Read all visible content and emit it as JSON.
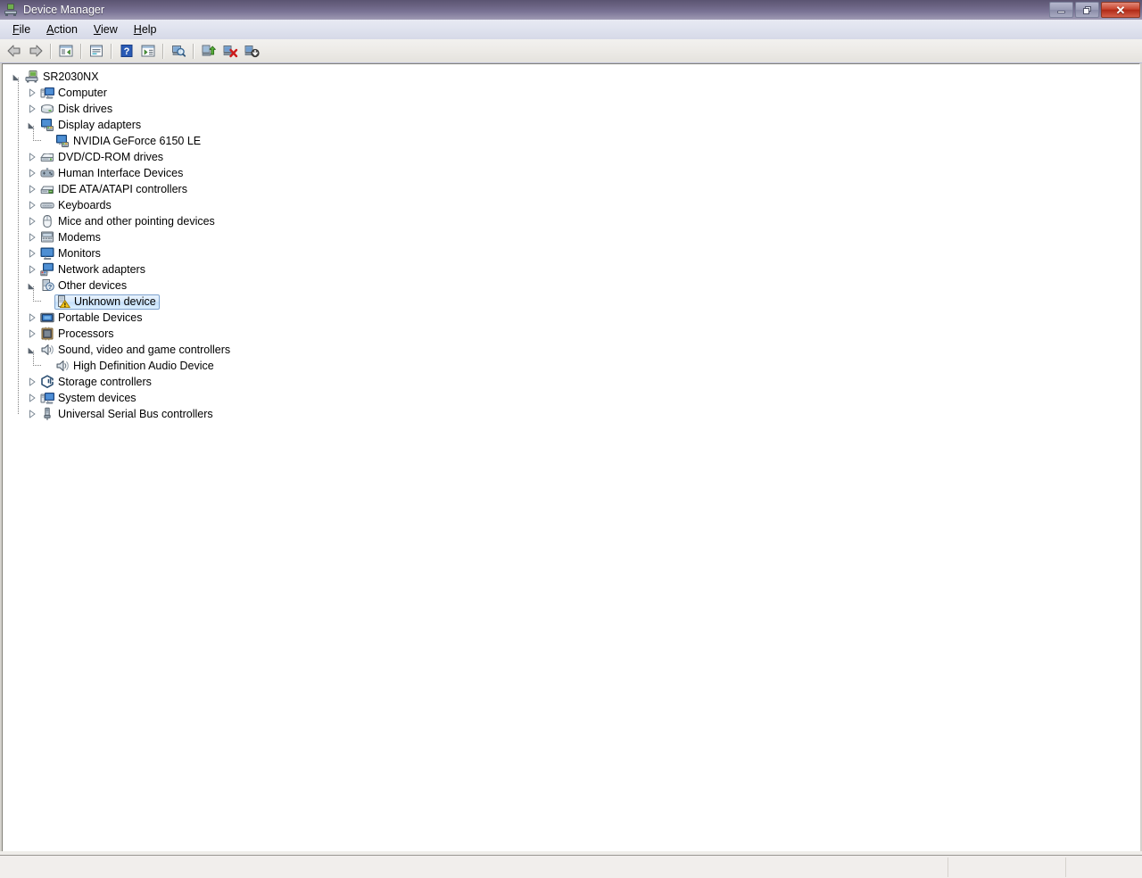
{
  "window": {
    "title": "Device Manager",
    "app_icon": "device-manager-icon",
    "controls": {
      "minimize_label": "Minimize",
      "restore_label": "Restore",
      "close_label": "✕"
    }
  },
  "menubar": {
    "items": [
      {
        "label": "File",
        "accel": "F"
      },
      {
        "label": "Action",
        "accel": "A"
      },
      {
        "label": "View",
        "accel": "V"
      },
      {
        "label": "Help",
        "accel": "H"
      }
    ]
  },
  "toolbar": {
    "buttons": [
      {
        "name": "back-button",
        "icon": "back-arrow-icon",
        "label": "Back"
      },
      {
        "name": "forward-button",
        "icon": "forward-arrow-icon",
        "label": "Forward"
      },
      {
        "name": "separator-1",
        "icon": "separator",
        "label": ""
      },
      {
        "name": "show-hide-console-tree-button",
        "icon": "console-tree-icon",
        "label": "Show/Hide Console Tree"
      },
      {
        "name": "separator-2",
        "icon": "separator",
        "label": ""
      },
      {
        "name": "properties-button",
        "icon": "properties-icon",
        "label": "Properties"
      },
      {
        "name": "separator-3",
        "icon": "separator",
        "label": ""
      },
      {
        "name": "help-button",
        "icon": "help-question-icon",
        "label": "Help"
      },
      {
        "name": "show-hide-action-pane-button",
        "icon": "action-pane-icon",
        "label": "Show/Hide Action Pane"
      },
      {
        "name": "separator-4",
        "icon": "separator",
        "label": ""
      },
      {
        "name": "scan-for-hardware-changes-button",
        "icon": "scan-magnifier-icon",
        "label": "Scan for hardware changes"
      },
      {
        "name": "separator-5",
        "icon": "separator",
        "label": ""
      },
      {
        "name": "update-driver-button",
        "icon": "update-driver-icon",
        "label": "Update Driver Software"
      },
      {
        "name": "uninstall-device-button",
        "icon": "uninstall-red-x-icon",
        "label": "Uninstall"
      },
      {
        "name": "disable-device-button",
        "icon": "disable-down-arrow-icon",
        "label": "Disable"
      }
    ]
  },
  "tree": {
    "nodes": [
      {
        "label": "SR2030NX",
        "indent": 0,
        "state": "expanded-root",
        "icon": "computer-tower-icon",
        "selected": false
      },
      {
        "label": "Computer",
        "indent": 1,
        "state": "collapsed",
        "icon": "computer-icon",
        "selected": false
      },
      {
        "label": "Disk drives",
        "indent": 1,
        "state": "collapsed",
        "icon": "disk-drive-icon",
        "selected": false
      },
      {
        "label": "Display adapters",
        "indent": 1,
        "state": "expanded",
        "icon": "display-adapter-icon",
        "selected": false
      },
      {
        "label": "NVIDIA GeForce 6150 LE",
        "indent": 2,
        "state": "leaf",
        "icon": "display-adapter-icon",
        "selected": false
      },
      {
        "label": "DVD/CD-ROM drives",
        "indent": 1,
        "state": "collapsed",
        "icon": "dvd-drive-icon",
        "selected": false
      },
      {
        "label": "Human Interface Devices",
        "indent": 1,
        "state": "collapsed",
        "icon": "hid-icon",
        "selected": false
      },
      {
        "label": "IDE ATA/ATAPI controllers",
        "indent": 1,
        "state": "collapsed",
        "icon": "ide-controller-icon",
        "selected": false
      },
      {
        "label": "Keyboards",
        "indent": 1,
        "state": "collapsed",
        "icon": "keyboard-icon",
        "selected": false
      },
      {
        "label": "Mice and other pointing devices",
        "indent": 1,
        "state": "collapsed",
        "icon": "mouse-icon",
        "selected": false
      },
      {
        "label": "Modems",
        "indent": 1,
        "state": "collapsed",
        "icon": "modem-icon",
        "selected": false
      },
      {
        "label": "Monitors",
        "indent": 1,
        "state": "collapsed",
        "icon": "monitor-icon",
        "selected": false
      },
      {
        "label": "Network adapters",
        "indent": 1,
        "state": "collapsed",
        "icon": "network-adapter-icon",
        "selected": false
      },
      {
        "label": "Other devices",
        "indent": 1,
        "state": "expanded",
        "icon": "other-devices-icon",
        "selected": false
      },
      {
        "label": "Unknown device",
        "indent": 2,
        "state": "leaf",
        "icon": "unknown-device-warning-icon",
        "selected": true
      },
      {
        "label": "Portable Devices",
        "indent": 1,
        "state": "collapsed",
        "icon": "portable-device-icon",
        "selected": false
      },
      {
        "label": "Processors",
        "indent": 1,
        "state": "collapsed",
        "icon": "processor-icon",
        "selected": false
      },
      {
        "label": "Sound, video and game controllers",
        "indent": 1,
        "state": "expanded",
        "icon": "speaker-icon",
        "selected": false
      },
      {
        "label": "High Definition Audio Device",
        "indent": 2,
        "state": "leaf",
        "icon": "speaker-icon",
        "selected": false
      },
      {
        "label": "Storage controllers",
        "indent": 1,
        "state": "collapsed",
        "icon": "storage-controller-icon",
        "selected": false
      },
      {
        "label": "System devices",
        "indent": 1,
        "state": "collapsed",
        "icon": "system-device-icon",
        "selected": false
      },
      {
        "label": "Universal Serial Bus controllers",
        "indent": 1,
        "state": "collapsed",
        "icon": "usb-icon",
        "selected": false
      }
    ]
  },
  "statusbar": {
    "panels": [
      {
        "name": "status-main",
        "text": ""
      },
      {
        "name": "status-panel-2",
        "text": ""
      },
      {
        "name": "status-panel-3",
        "text": ""
      }
    ]
  },
  "colors": {
    "titlebar_start": "#5b5472",
    "titlebar_end": "#9f9ab4",
    "close_button": "#c9462f",
    "selection_fill": "#cfe6fb",
    "selection_border": "#7da2ce",
    "warning_yellow": "#f5c518",
    "tree_background": "#ffffff",
    "statusbar_background": "#f1eeec"
  }
}
